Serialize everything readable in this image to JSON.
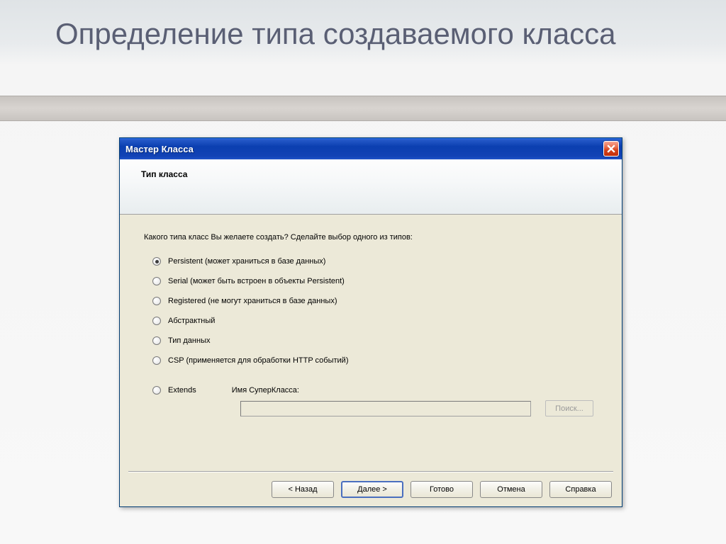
{
  "slide": {
    "title": "Определение типа создаваемого класса"
  },
  "dialog": {
    "title": "Мастер Класса",
    "header_subtitle": "Тип класса",
    "prompt": "Какого типа класс Вы желаете создать? Сделайте выбор одного из типов:",
    "options": [
      {
        "label": "Persistent  (может храниться в базе данных)",
        "selected": true
      },
      {
        "label": "Serial   (может быть встроен в объекты Persistent)",
        "selected": false
      },
      {
        "label": "Registered  (не могут храниться в базе данных)",
        "selected": false
      },
      {
        "label": "Абстрактный",
        "selected": false
      },
      {
        "label": "Тип данных",
        "selected": false
      },
      {
        "label": "CSP  (применяется для обработки HTTP событий)",
        "selected": false
      }
    ],
    "extends_label": "Extends",
    "superclass_label": "Имя СуперКласса:",
    "superclass_value": "",
    "search_button": "Поиск...",
    "buttons": {
      "back": "< Назад",
      "next": "Далее >",
      "finish": "Готово",
      "cancel": "Отмена",
      "help": "Справка"
    }
  }
}
